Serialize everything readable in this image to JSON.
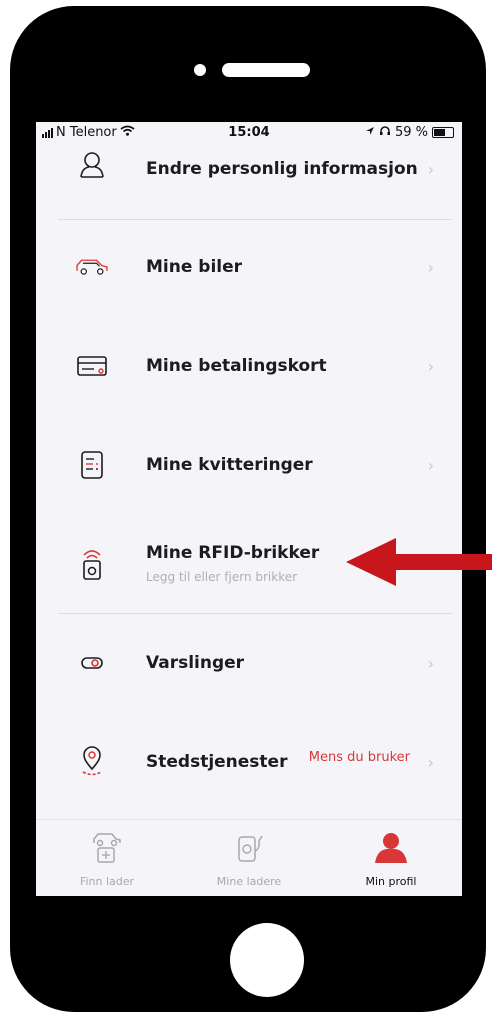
{
  "status": {
    "carrier": "N Telenor",
    "time": "15:04",
    "battery": "59 %"
  },
  "menu": [
    {
      "label": "Endre personlig informasjon",
      "icon": "person-icon"
    },
    {
      "label": "Mine biler",
      "icon": "car-icon"
    },
    {
      "label": "Mine betalingskort",
      "icon": "credit-card-icon"
    },
    {
      "label": "Mine kvitteringer",
      "icon": "receipt-icon"
    },
    {
      "label": "Mine RFID-brikker",
      "sublabel": "Legg til eller fjern brikker",
      "icon": "rfid-tag-icon"
    },
    {
      "label": "Varslinger",
      "icon": "toggle-icon"
    },
    {
      "label": "Stedstjenester",
      "value": "Mens du bruker",
      "icon": "location-pin-icon"
    }
  ],
  "tabs": [
    {
      "label": "Finn lader",
      "icon": "find-charger-icon",
      "active": false
    },
    {
      "label": "Mine ladere",
      "icon": "my-chargers-icon",
      "active": false
    },
    {
      "label": "Min profil",
      "icon": "profile-icon",
      "active": true
    }
  ],
  "colors": {
    "accent": "#d93737",
    "arrow": "#c8161d",
    "text": "#1c1c1c",
    "inactive": "#a8a8ac"
  }
}
